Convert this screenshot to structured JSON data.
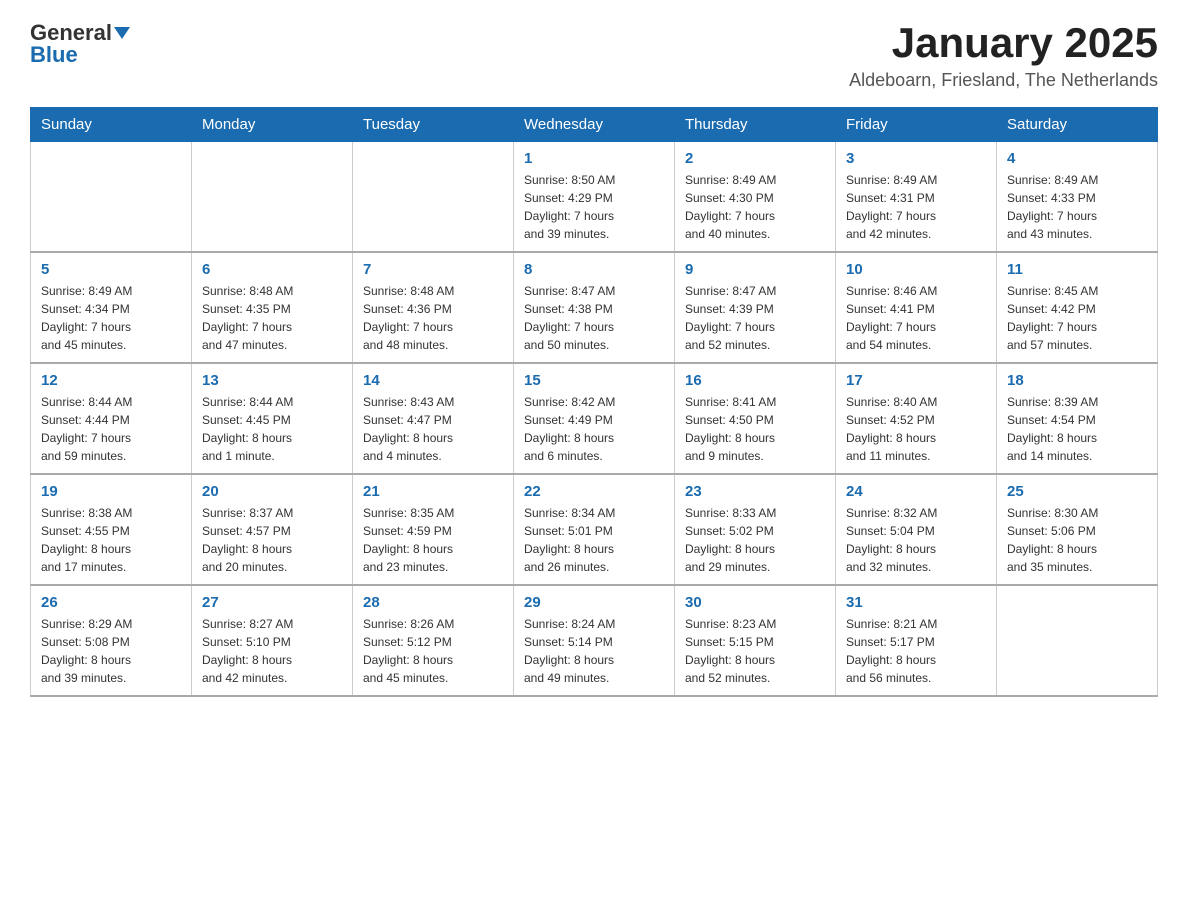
{
  "logo": {
    "general": "General",
    "blue": "Blue"
  },
  "title": "January 2025",
  "subtitle": "Aldeboarn, Friesland, The Netherlands",
  "days_of_week": [
    "Sunday",
    "Monday",
    "Tuesday",
    "Wednesday",
    "Thursday",
    "Friday",
    "Saturday"
  ],
  "weeks": [
    [
      {
        "num": "",
        "info": ""
      },
      {
        "num": "",
        "info": ""
      },
      {
        "num": "",
        "info": ""
      },
      {
        "num": "1",
        "info": "Sunrise: 8:50 AM\nSunset: 4:29 PM\nDaylight: 7 hours\nand 39 minutes."
      },
      {
        "num": "2",
        "info": "Sunrise: 8:49 AM\nSunset: 4:30 PM\nDaylight: 7 hours\nand 40 minutes."
      },
      {
        "num": "3",
        "info": "Sunrise: 8:49 AM\nSunset: 4:31 PM\nDaylight: 7 hours\nand 42 minutes."
      },
      {
        "num": "4",
        "info": "Sunrise: 8:49 AM\nSunset: 4:33 PM\nDaylight: 7 hours\nand 43 minutes."
      }
    ],
    [
      {
        "num": "5",
        "info": "Sunrise: 8:49 AM\nSunset: 4:34 PM\nDaylight: 7 hours\nand 45 minutes."
      },
      {
        "num": "6",
        "info": "Sunrise: 8:48 AM\nSunset: 4:35 PM\nDaylight: 7 hours\nand 47 minutes."
      },
      {
        "num": "7",
        "info": "Sunrise: 8:48 AM\nSunset: 4:36 PM\nDaylight: 7 hours\nand 48 minutes."
      },
      {
        "num": "8",
        "info": "Sunrise: 8:47 AM\nSunset: 4:38 PM\nDaylight: 7 hours\nand 50 minutes."
      },
      {
        "num": "9",
        "info": "Sunrise: 8:47 AM\nSunset: 4:39 PM\nDaylight: 7 hours\nand 52 minutes."
      },
      {
        "num": "10",
        "info": "Sunrise: 8:46 AM\nSunset: 4:41 PM\nDaylight: 7 hours\nand 54 minutes."
      },
      {
        "num": "11",
        "info": "Sunrise: 8:45 AM\nSunset: 4:42 PM\nDaylight: 7 hours\nand 57 minutes."
      }
    ],
    [
      {
        "num": "12",
        "info": "Sunrise: 8:44 AM\nSunset: 4:44 PM\nDaylight: 7 hours\nand 59 minutes."
      },
      {
        "num": "13",
        "info": "Sunrise: 8:44 AM\nSunset: 4:45 PM\nDaylight: 8 hours\nand 1 minute."
      },
      {
        "num": "14",
        "info": "Sunrise: 8:43 AM\nSunset: 4:47 PM\nDaylight: 8 hours\nand 4 minutes."
      },
      {
        "num": "15",
        "info": "Sunrise: 8:42 AM\nSunset: 4:49 PM\nDaylight: 8 hours\nand 6 minutes."
      },
      {
        "num": "16",
        "info": "Sunrise: 8:41 AM\nSunset: 4:50 PM\nDaylight: 8 hours\nand 9 minutes."
      },
      {
        "num": "17",
        "info": "Sunrise: 8:40 AM\nSunset: 4:52 PM\nDaylight: 8 hours\nand 11 minutes."
      },
      {
        "num": "18",
        "info": "Sunrise: 8:39 AM\nSunset: 4:54 PM\nDaylight: 8 hours\nand 14 minutes."
      }
    ],
    [
      {
        "num": "19",
        "info": "Sunrise: 8:38 AM\nSunset: 4:55 PM\nDaylight: 8 hours\nand 17 minutes."
      },
      {
        "num": "20",
        "info": "Sunrise: 8:37 AM\nSunset: 4:57 PM\nDaylight: 8 hours\nand 20 minutes."
      },
      {
        "num": "21",
        "info": "Sunrise: 8:35 AM\nSunset: 4:59 PM\nDaylight: 8 hours\nand 23 minutes."
      },
      {
        "num": "22",
        "info": "Sunrise: 8:34 AM\nSunset: 5:01 PM\nDaylight: 8 hours\nand 26 minutes."
      },
      {
        "num": "23",
        "info": "Sunrise: 8:33 AM\nSunset: 5:02 PM\nDaylight: 8 hours\nand 29 minutes."
      },
      {
        "num": "24",
        "info": "Sunrise: 8:32 AM\nSunset: 5:04 PM\nDaylight: 8 hours\nand 32 minutes."
      },
      {
        "num": "25",
        "info": "Sunrise: 8:30 AM\nSunset: 5:06 PM\nDaylight: 8 hours\nand 35 minutes."
      }
    ],
    [
      {
        "num": "26",
        "info": "Sunrise: 8:29 AM\nSunset: 5:08 PM\nDaylight: 8 hours\nand 39 minutes."
      },
      {
        "num": "27",
        "info": "Sunrise: 8:27 AM\nSunset: 5:10 PM\nDaylight: 8 hours\nand 42 minutes."
      },
      {
        "num": "28",
        "info": "Sunrise: 8:26 AM\nSunset: 5:12 PM\nDaylight: 8 hours\nand 45 minutes."
      },
      {
        "num": "29",
        "info": "Sunrise: 8:24 AM\nSunset: 5:14 PM\nDaylight: 8 hours\nand 49 minutes."
      },
      {
        "num": "30",
        "info": "Sunrise: 8:23 AM\nSunset: 5:15 PM\nDaylight: 8 hours\nand 52 minutes."
      },
      {
        "num": "31",
        "info": "Sunrise: 8:21 AM\nSunset: 5:17 PM\nDaylight: 8 hours\nand 56 minutes."
      },
      {
        "num": "",
        "info": ""
      }
    ]
  ]
}
